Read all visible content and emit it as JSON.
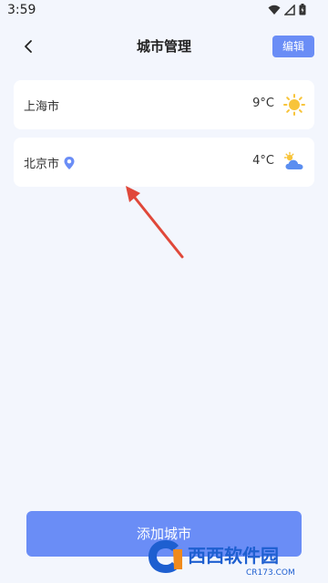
{
  "status_bar": {
    "time": "3:59"
  },
  "header": {
    "title": "城市管理",
    "edit_label": "编辑"
  },
  "cities": [
    {
      "name": "上海市",
      "temp": "9°C",
      "weather_icon": "sun-icon",
      "is_current_location": false
    },
    {
      "name": "北京市",
      "temp": "4°C",
      "weather_icon": "cloud-sun-icon",
      "is_current_location": true
    }
  ],
  "add_button": {
    "label": "添加城市"
  },
  "watermark": {
    "text": "西西软件园",
    "subtext": "CR173.COM"
  },
  "colors": {
    "accent": "#6a8df6",
    "background": "#f3f6fd",
    "card": "#ffffff",
    "sun": "#f8c43a",
    "cloud": "#5b8ef0",
    "arrow": "#e0483a"
  }
}
